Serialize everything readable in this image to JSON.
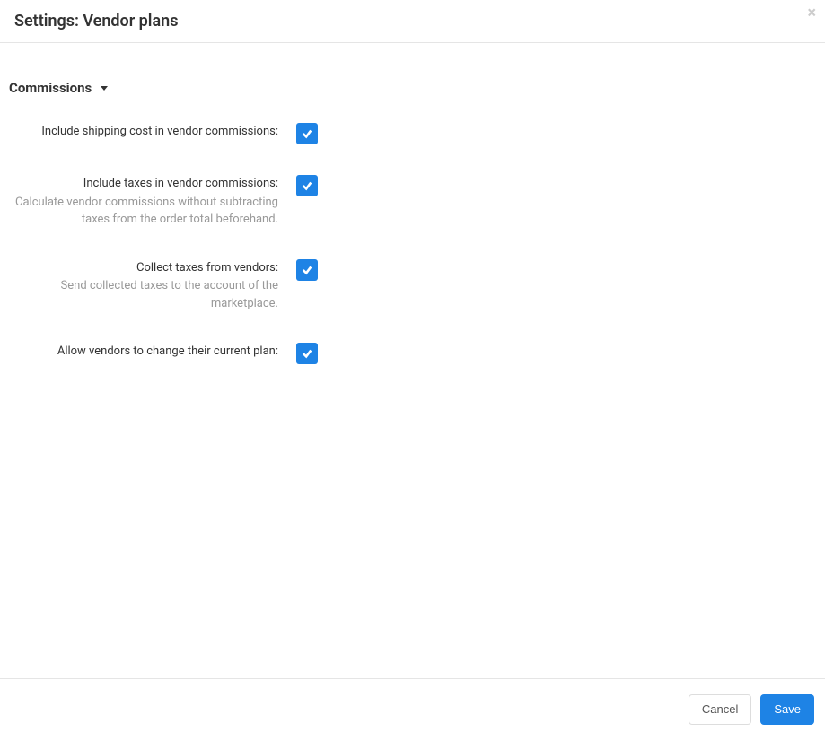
{
  "header": {
    "title": "Settings: Vendor plans"
  },
  "section": {
    "title": "Commissions"
  },
  "fields": {
    "include_shipping": {
      "label": "Include shipping cost in vendor commissions:",
      "checked": true
    },
    "include_taxes": {
      "label": "Include taxes in vendor commissions:",
      "description": "Calculate vendor commissions without subtracting taxes from the order total beforehand.",
      "checked": true
    },
    "collect_taxes": {
      "label": "Collect taxes from vendors:",
      "description": "Send collected taxes to the account of the marketplace.",
      "checked": true
    },
    "allow_change_plan": {
      "label": "Allow vendors to change their current plan:",
      "checked": true
    }
  },
  "footer": {
    "cancel_label": "Cancel",
    "save_label": "Save"
  }
}
